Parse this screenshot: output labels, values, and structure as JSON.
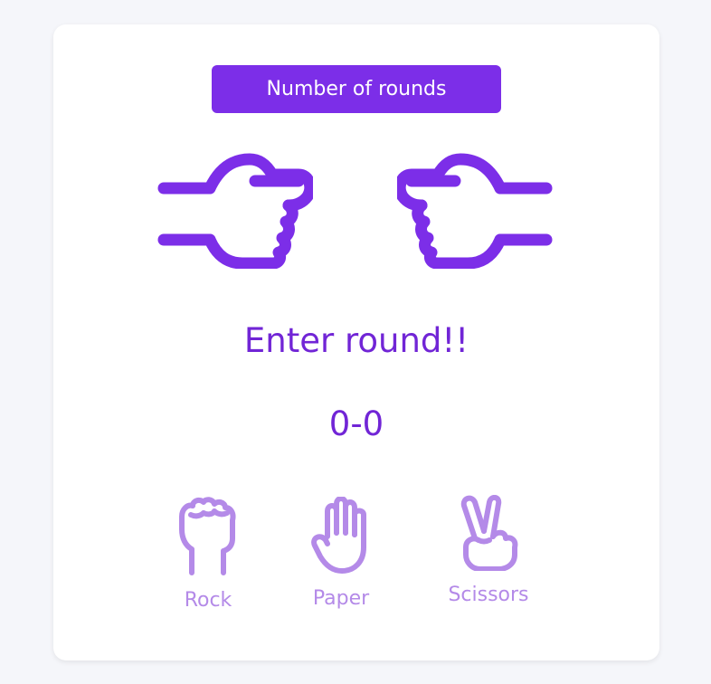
{
  "header": {
    "rounds_button_label": "Number of rounds"
  },
  "game": {
    "message": "Enter round!!",
    "score": "0-0"
  },
  "choices": [
    {
      "label": "Rock",
      "icon": "fist-icon"
    },
    {
      "label": "Paper",
      "icon": "open-hand-icon"
    },
    {
      "label": "Scissors",
      "icon": "victory-hand-icon"
    }
  ],
  "colors": {
    "accent": "#7c2ee8",
    "text_primary": "#7125d6",
    "choice_muted": "#b48ae8",
    "background": "#f5f6fa",
    "card": "#ffffff"
  }
}
